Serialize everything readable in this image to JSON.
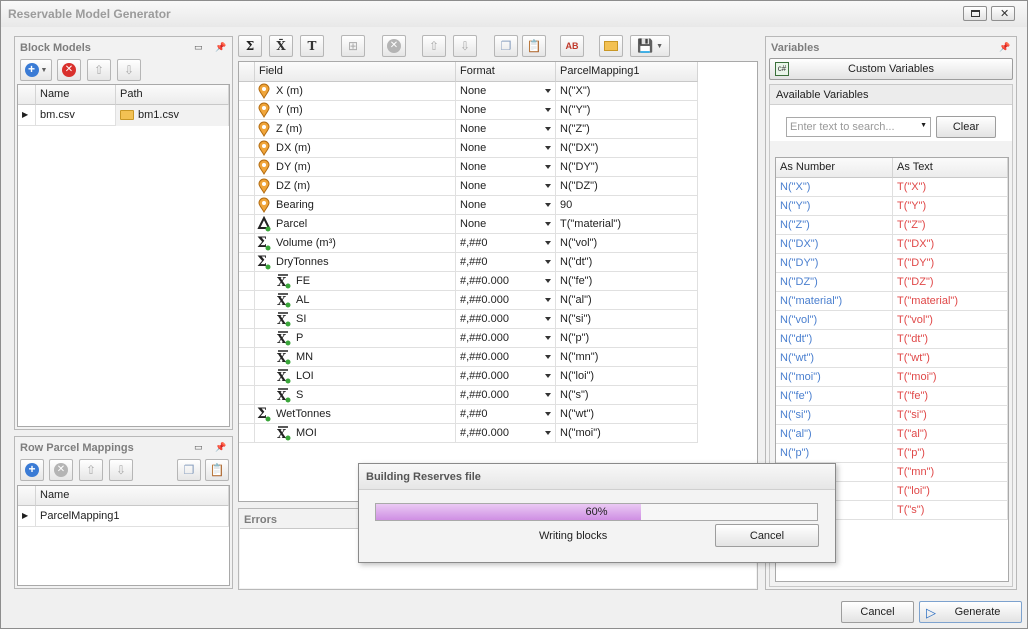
{
  "window": {
    "title": "Reservable Model Generator"
  },
  "block_models": {
    "title": "Block Models",
    "columns": [
      "Name",
      "Path"
    ],
    "rows": [
      {
        "name": "bm.csv",
        "path": "bm1.csv"
      }
    ]
  },
  "row_parcel": {
    "title": "Row Parcel Mappings",
    "columns": [
      "Name"
    ],
    "rows": [
      {
        "name": "ParcelMapping1"
      }
    ]
  },
  "mapping_grid": {
    "columns": [
      "Field",
      "Format",
      "ParcelMapping1"
    ],
    "rows": [
      {
        "icon": "pin",
        "indent": 0,
        "field": "X (m)",
        "format": "None",
        "mapping": "N(\"X\")"
      },
      {
        "icon": "pin",
        "indent": 0,
        "field": "Y (m)",
        "format": "None",
        "mapping": "N(\"Y\")"
      },
      {
        "icon": "pin",
        "indent": 0,
        "field": "Z (m)",
        "format": "None",
        "mapping": "N(\"Z\")"
      },
      {
        "icon": "pin",
        "indent": 0,
        "field": "DX (m)",
        "format": "None",
        "mapping": "N(\"DX\")"
      },
      {
        "icon": "pin",
        "indent": 0,
        "field": "DY (m)",
        "format": "None",
        "mapping": "N(\"DY\")"
      },
      {
        "icon": "pin",
        "indent": 0,
        "field": "DZ (m)",
        "format": "None",
        "mapping": "N(\"DZ\")"
      },
      {
        "icon": "pin",
        "indent": 0,
        "field": "Bearing",
        "format": "None",
        "mapping": "90"
      },
      {
        "icon": "delta",
        "indent": 0,
        "field": "Parcel",
        "format": "None",
        "mapping": "T(\"material\")"
      },
      {
        "icon": "sigma",
        "indent": 0,
        "field": "Volume (m³)",
        "format": "#,##0",
        "mapping": "N(\"vol\")"
      },
      {
        "icon": "sigma",
        "indent": 0,
        "field": "DryTonnes",
        "format": "#,##0",
        "mapping": "N(\"dt\")"
      },
      {
        "icon": "xbar",
        "indent": 1,
        "field": "FE",
        "format": "#,##0.000",
        "mapping": "N(\"fe\")"
      },
      {
        "icon": "xbar",
        "indent": 1,
        "field": "AL",
        "format": "#,##0.000",
        "mapping": "N(\"al\")"
      },
      {
        "icon": "xbar",
        "indent": 1,
        "field": "SI",
        "format": "#,##0.000",
        "mapping": "N(\"si\")"
      },
      {
        "icon": "xbar",
        "indent": 1,
        "field": "P",
        "format": "#,##0.000",
        "mapping": "N(\"p\")"
      },
      {
        "icon": "xbar",
        "indent": 1,
        "field": "MN",
        "format": "#,##0.000",
        "mapping": "N(\"mn\")"
      },
      {
        "icon": "xbar",
        "indent": 1,
        "field": "LOI",
        "format": "#,##0.000",
        "mapping": "N(\"loi\")"
      },
      {
        "icon": "xbar",
        "indent": 1,
        "field": "S",
        "format": "#,##0.000",
        "mapping": "N(\"s\")"
      },
      {
        "icon": "sigma",
        "indent": 0,
        "field": "WetTonnes",
        "format": "#,##0",
        "mapping": "N(\"wt\")"
      },
      {
        "icon": "xbar",
        "indent": 1,
        "field": "MOI",
        "format": "#,##0.000",
        "mapping": "N(\"moi\")"
      }
    ]
  },
  "errors": {
    "title": "Errors"
  },
  "variables": {
    "title": "Variables",
    "custom_button": "Custom Variables",
    "available_title": "Available Variables",
    "search_placeholder": "Enter text to search...",
    "clear_button": "Clear",
    "columns": [
      "As Number",
      "As Text"
    ],
    "rows": [
      {
        "num": "N(\"X\")",
        "text": "T(\"X\")"
      },
      {
        "num": "N(\"Y\")",
        "text": "T(\"Y\")"
      },
      {
        "num": "N(\"Z\")",
        "text": "T(\"Z\")"
      },
      {
        "num": "N(\"DX\")",
        "text": "T(\"DX\")"
      },
      {
        "num": "N(\"DY\")",
        "text": "T(\"DY\")"
      },
      {
        "num": "N(\"DZ\")",
        "text": "T(\"DZ\")"
      },
      {
        "num": "N(\"material\")",
        "text": "T(\"material\")"
      },
      {
        "num": "N(\"vol\")",
        "text": "T(\"vol\")"
      },
      {
        "num": "N(\"dt\")",
        "text": "T(\"dt\")"
      },
      {
        "num": "N(\"wt\")",
        "text": "T(\"wt\")"
      },
      {
        "num": "N(\"moi\")",
        "text": "T(\"moi\")"
      },
      {
        "num": "N(\"fe\")",
        "text": "T(\"fe\")"
      },
      {
        "num": "N(\"si\")",
        "text": "T(\"si\")"
      },
      {
        "num": "N(\"al\")",
        "text": "T(\"al\")"
      },
      {
        "num": "N(\"p\")",
        "text": "T(\"p\")"
      },
      {
        "num": "",
        "text": "T(\"mn\")"
      },
      {
        "num": "",
        "text": "T(\"loi\")"
      },
      {
        "num": "",
        "text": "T(\"s\")"
      }
    ]
  },
  "progress_dialog": {
    "title": "Building Reserves file",
    "percent_label": "60%",
    "progress": 0.6,
    "status": "Writing blocks",
    "cancel": "Cancel"
  },
  "footer": {
    "cancel": "Cancel",
    "generate": "Generate"
  },
  "colors": {
    "number": "#4a7fcf",
    "text": "#e04848",
    "progress": "#d9a6e8"
  }
}
